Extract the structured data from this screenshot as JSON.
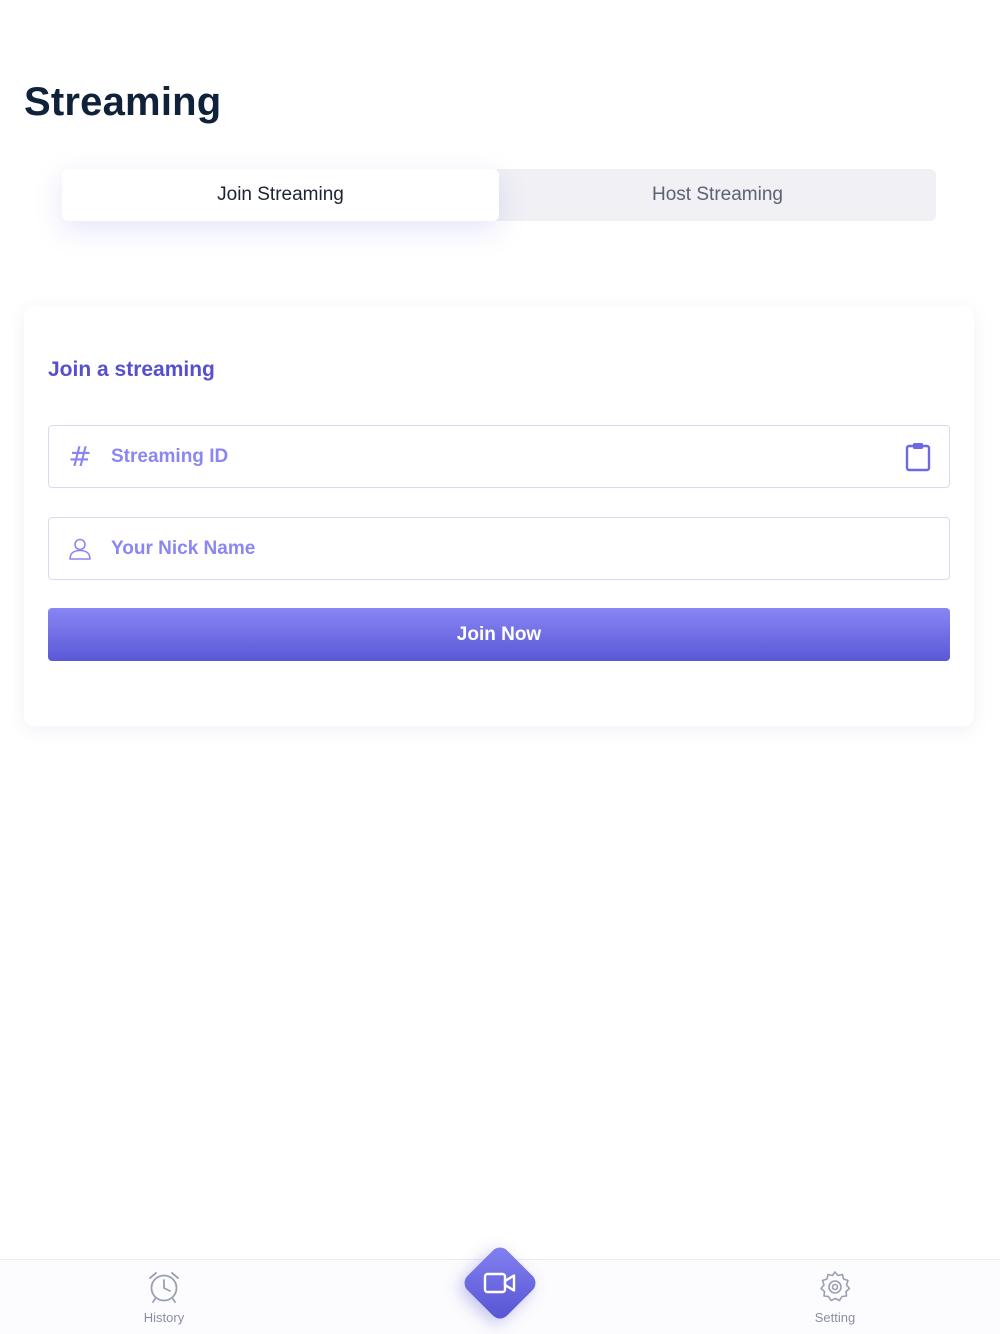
{
  "header": {
    "title": "Streaming"
  },
  "segmented": {
    "tabs": [
      {
        "label": "Join Streaming",
        "active": true
      },
      {
        "label": "Host Streaming",
        "active": false
      }
    ]
  },
  "join_card": {
    "title": "Join a streaming",
    "streaming_id": {
      "value": "",
      "placeholder": "Streaming ID",
      "lead_icon": "hash-icon",
      "trail_icon": "clipboard-icon"
    },
    "nickname": {
      "value": "",
      "placeholder": "Your Nick Name",
      "lead_icon": "user-icon"
    },
    "join_button": "Join Now"
  },
  "tabbar": {
    "items": [
      {
        "label": "History",
        "icon": "alarm-clock-icon"
      },
      {
        "label": "",
        "icon": "video-camera-icon"
      },
      {
        "label": "Setting",
        "icon": "gear-icon"
      }
    ]
  },
  "colors": {
    "accent": "#5b58d6",
    "accent_light": "#8886f4",
    "title": "#0f2239",
    "segment_bg": "#f0f0f5",
    "input_border": "#d9daf2"
  }
}
